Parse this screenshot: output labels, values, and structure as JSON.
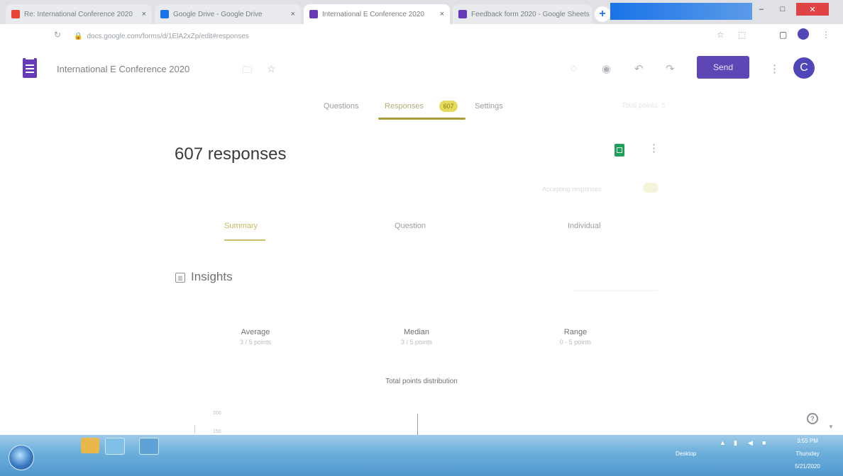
{
  "browser": {
    "tabs": [
      {
        "title": "Re: International Conference 2020",
        "favicon_color": "#ea4335",
        "active": false
      },
      {
        "title": "Google Drive - Google Drive",
        "favicon_color": "#1a73e8",
        "active": false
      },
      {
        "title": "International E Conference 2020",
        "favicon_color": "#673ab7",
        "active": true
      },
      {
        "title": "Feedback form 2020 - Google Sheets",
        "favicon_color": "#673ab7",
        "active": false
      }
    ],
    "tab_close_glyph": "×",
    "new_tab_glyph": "+",
    "url": "docs.google.com/forms/d/1ElA2xZp/edit#responses",
    "window_controls": {
      "minimize": "–",
      "maximize": "□",
      "close": "✕",
      "close_color": "#e04343"
    }
  },
  "form": {
    "title": "International E Conference 2020",
    "send_label": "Send",
    "avatar_letter": "C",
    "tabs": {
      "questions": "Questions",
      "responses": "Responses",
      "responses_badge": "607",
      "settings": "Settings",
      "faded_label": "Total points: 5"
    }
  },
  "responses": {
    "count_label": "607 responses",
    "accepting_label": "Accepting responses",
    "subtabs": [
      "Summary",
      "Question",
      "Individual"
    ],
    "insights_label": "Insights",
    "stats": [
      {
        "label": "Average",
        "value": "3 / 5 points"
      },
      {
        "label": "Median",
        "value": "3 / 5 points"
      },
      {
        "label": "Range",
        "value": "0 - 5 points"
      }
    ],
    "chart_title": "Total points distribution",
    "axis_top_tick": "200",
    "axis_second_tick": "150"
  },
  "taskbar": {
    "language": "Desktop",
    "time": "3:55 PM",
    "day": "Thursday",
    "date": "5/21/2020"
  },
  "colors": {
    "send": "#5e46b4",
    "avatar": "#4f46b8",
    "badge": "#e6da5c",
    "sheets": "#1e9f5b",
    "form_icon": "#673ab7"
  }
}
